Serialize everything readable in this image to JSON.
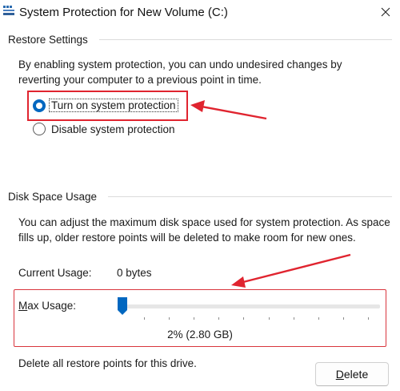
{
  "window": {
    "title": "System Protection for New Volume (C:)",
    "close_icon": "close-icon",
    "app_icon": "system-protection-icon"
  },
  "restore_settings": {
    "header": "Restore Settings",
    "description_line1": "By enabling system protection, you can undo undesired changes by",
    "description_line2": "reverting your computer to a previous point in time.",
    "options": [
      {
        "label": "Turn on system protection",
        "selected": true
      },
      {
        "label": "Disable system protection",
        "selected": false
      }
    ]
  },
  "disk_space": {
    "header": "Disk Space Usage",
    "description_line1": "You can adjust the maximum disk space used for system protection. As space",
    "description_line2": "fills up, older restore points will be deleted to make room for new ones.",
    "current_usage_label": "Current Usage:",
    "current_usage_value": "0 bytes",
    "max_usage_label": "Max Usage:",
    "max_usage_value": "2% (2.80 GB)",
    "max_usage_percent": 2,
    "delete_text": "Delete all restore points for this drive.",
    "delete_button": "Delete"
  },
  "colors": {
    "accent": "#0067c0",
    "annotation_red": "#e0242f"
  }
}
